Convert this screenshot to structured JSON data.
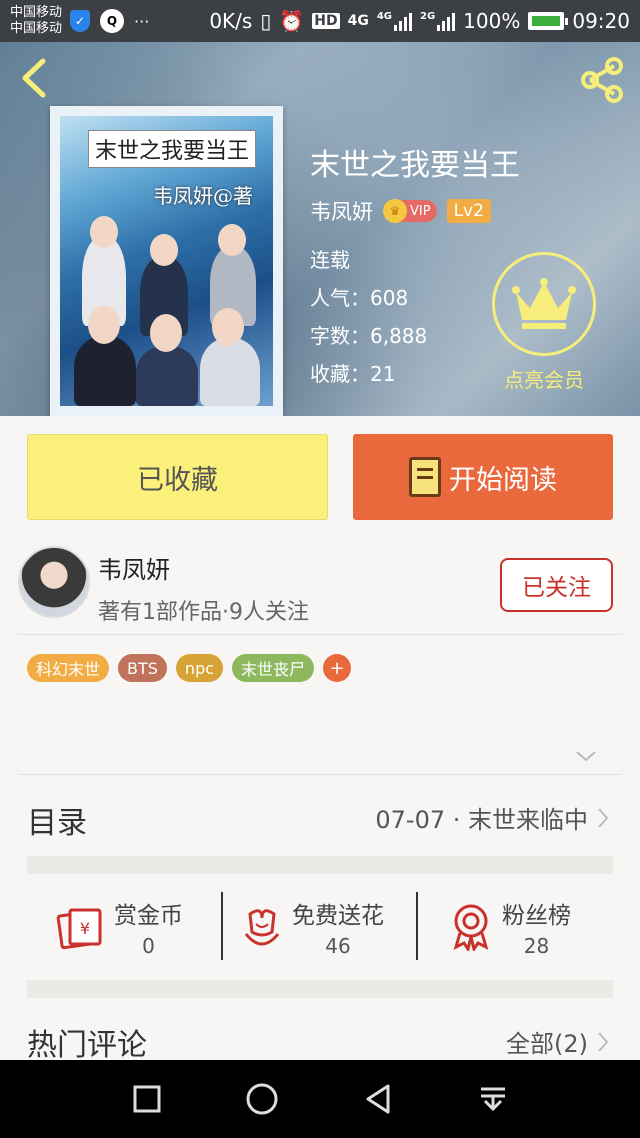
{
  "status_bar": {
    "carrier_1": "中国移动",
    "carrier_2": "中国移动",
    "speed": "0K/s",
    "network_4g": "4G",
    "network_4g_small": "4G",
    "network_2g": "2G",
    "hd": "HD",
    "battery": "100%",
    "time": "09:20"
  },
  "book": {
    "title": "末世之我要当王",
    "cover_title": "末世之我要当王",
    "cover_author": "韦凤妍@著",
    "author": "韦凤妍",
    "vip_badge": "VIP",
    "level": "Lv2",
    "status": "连载",
    "popularity_label": "人气：",
    "popularity": "608",
    "word_count_label": "字数：",
    "word_count": "6,888",
    "favorites_label": "收藏：",
    "favorites": "21"
  },
  "member": {
    "label": "点亮会员"
  },
  "actions": {
    "favorite_label": "已收藏",
    "read_label": "开始阅读"
  },
  "author_card": {
    "name": "韦凤妍",
    "subtitle": "著有1部作品·9人关注",
    "follow_label": "已关注"
  },
  "tags": [
    {
      "label": "科幻末世",
      "color": "#f1ad44"
    },
    {
      "label": "BTS",
      "color": "#c0725a"
    },
    {
      "label": "npc",
      "color": "#d6a334"
    },
    {
      "label": "末世丧尸",
      "color": "#8db85e"
    },
    {
      "label": "+",
      "color": "#e9693c"
    }
  ],
  "toc": {
    "label": "目录",
    "latest": "07-07 · 末世来临中"
  },
  "stats": {
    "reward": {
      "label": "赏金币",
      "value": "0"
    },
    "flowers": {
      "label": "免费送花",
      "value": "46"
    },
    "fans": {
      "label": "粉丝榜",
      "value": "28"
    }
  },
  "comments": {
    "label": "热门评论",
    "all_label": "全部(2)"
  },
  "colors": {
    "accent_orange": "#e9693c",
    "fav_yellow": "#fbf17a",
    "follow_red": "#c8312c",
    "member_gold": "#f7ed7a"
  }
}
